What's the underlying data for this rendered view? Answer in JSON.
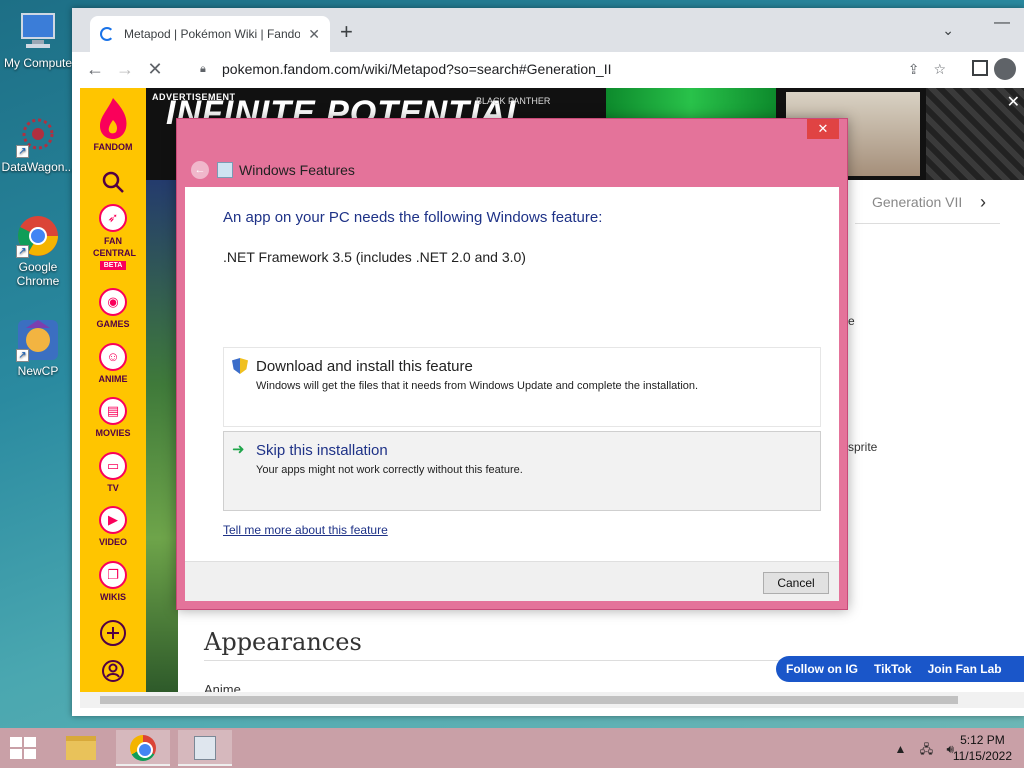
{
  "desktop": {
    "icons": [
      {
        "label": "My Compute"
      },
      {
        "label": "DataWagon..."
      },
      {
        "label": "Google Chrome"
      },
      {
        "label": "NewCP"
      }
    ]
  },
  "browser": {
    "tab_title": "Metapod | Pokémon Wiki | Fando",
    "url": "pokemon.fandom.com/wiki/Metapod?so=search#Generation_II",
    "new_tab": "+",
    "tab_menu": "⌄",
    "minimize": "—"
  },
  "fandom": {
    "items": [
      {
        "label": "FANDOM"
      },
      {
        "label": "FAN CENTRAL",
        "badge": "BETA"
      },
      {
        "label": "GAMES"
      },
      {
        "label": "ANIME"
      },
      {
        "label": "MOVIES"
      },
      {
        "label": "TV"
      },
      {
        "label": "VIDEO"
      },
      {
        "label": "WIKIS"
      }
    ]
  },
  "ad": {
    "label": "ADVERTISEMENT",
    "headline": "INFINITE POTENTIAL",
    "marvel": "BLACK PANTHER"
  },
  "page": {
    "gen_tab": "Generation VII",
    "frag_e": "e",
    "frag_sprite": "sprite",
    "appearances": "Appearances",
    "anime_frag": "Anime",
    "social": [
      "Follow on IG",
      "TikTok",
      "Join Fan Lab"
    ]
  },
  "dialog": {
    "title": "Windows Features",
    "close": "✕",
    "heading": "An app on your PC needs the following Windows feature:",
    "feature": ".NET Framework 3.5 (includes .NET 2.0 and 3.0)",
    "option1_title": "Download and install this feature",
    "option1_desc": "Windows will get the files that it needs from Windows Update and complete the installation.",
    "option2_title": "Skip this installation",
    "option2_desc": "Your apps might not work correctly without this feature.",
    "link": "Tell me more about this feature",
    "cancel": "Cancel"
  },
  "taskbar": {
    "time": "5:12 PM",
    "date": "11/15/2022"
  },
  "colors": {
    "dialog_frame": "#e4739a",
    "fandom_yellow": "#ffc500",
    "link_blue": "#1e3287"
  }
}
